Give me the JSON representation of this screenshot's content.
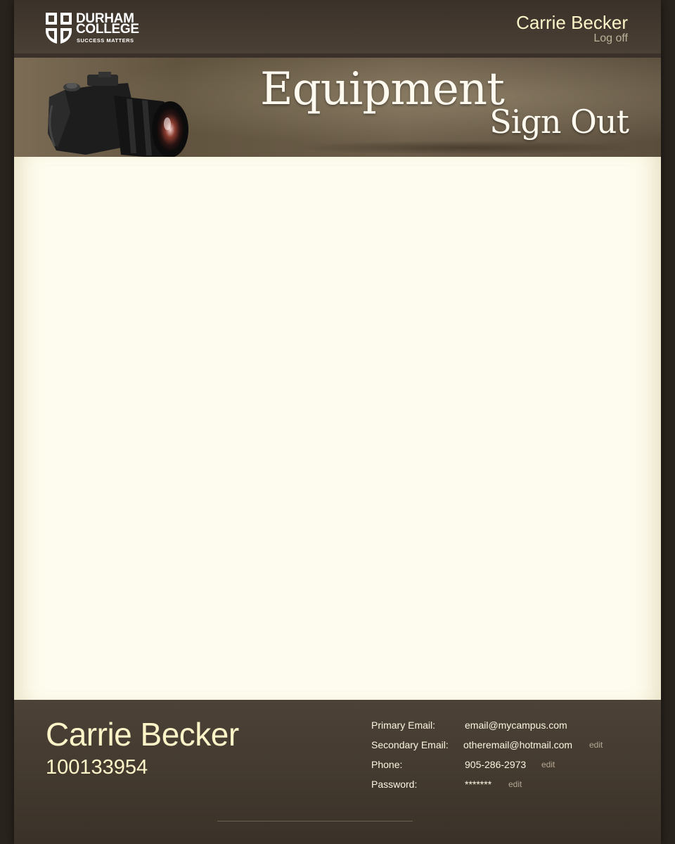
{
  "header": {
    "logo": {
      "line1": "DURHAM",
      "line2": "COLLEGE",
      "tagline": "SUCCESS MATTERS"
    },
    "user_name": "Carrie Becker",
    "logoff_label": "Log off"
  },
  "banner": {
    "title_line1": "Equipment",
    "title_line2": "Sign Out"
  },
  "profile": {
    "name": "Carrie Becker",
    "student_id": "100133954",
    "fields": [
      {
        "label": "Primary Email:",
        "value": "email@mycampus.com",
        "edit": ""
      },
      {
        "label": "Secondary Email:",
        "value": "otheremail@hotmail.com",
        "edit": "edit"
      },
      {
        "label": "Phone:",
        "value": "905-286-2973",
        "edit": "edit"
      },
      {
        "label": "Password:",
        "value": "*******",
        "edit": "edit"
      }
    ]
  },
  "colors": {
    "accent_text": "#fdf4c8",
    "content_bg": "#fefcee",
    "bar_dark": "#3a3129"
  }
}
